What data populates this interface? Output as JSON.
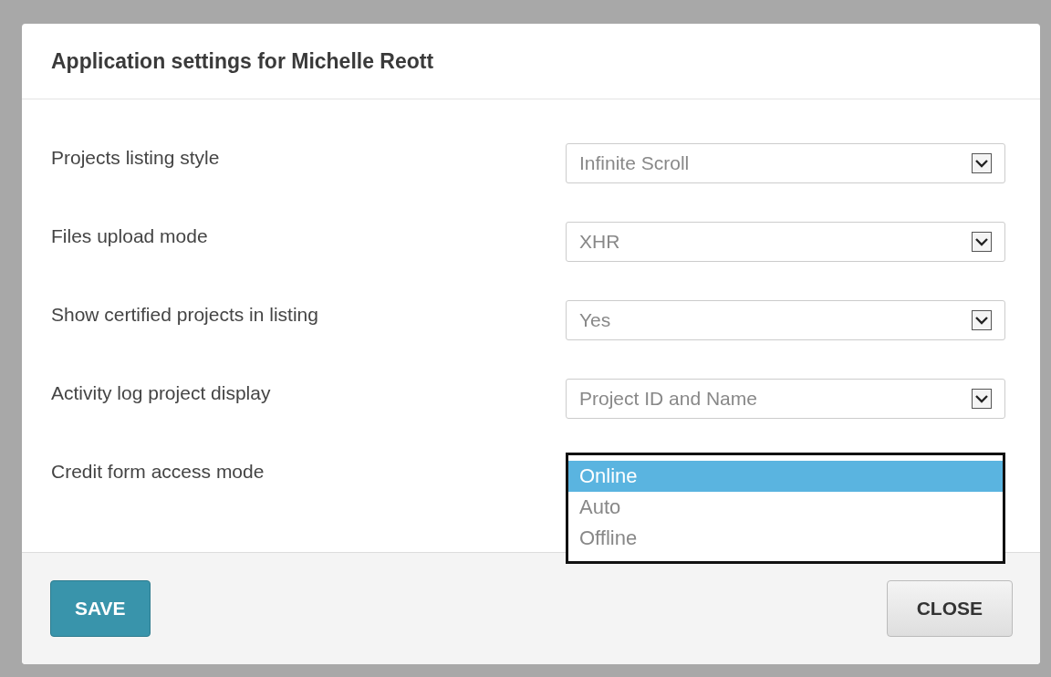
{
  "dialog": {
    "title": "Application settings for Michelle Reott"
  },
  "settings": [
    {
      "label": "Projects listing style",
      "kind": "select",
      "value": "Infinite Scroll"
    },
    {
      "label": "Files upload mode",
      "kind": "select",
      "value": "XHR"
    },
    {
      "label": "Show certified projects in listing",
      "kind": "select",
      "value": "Yes"
    },
    {
      "label": "Activity log project display",
      "kind": "select",
      "value": "Project ID and Name"
    },
    {
      "label": "Credit form access mode",
      "kind": "listbox",
      "options": [
        {
          "label": "Online",
          "selected": true
        },
        {
          "label": "Auto",
          "selected": false
        },
        {
          "label": "Offline",
          "selected": false
        }
      ]
    }
  ],
  "buttons": [
    {
      "label": "SAVE",
      "kind": "primary"
    },
    {
      "label": "CLOSE",
      "kind": "secondary"
    }
  ]
}
